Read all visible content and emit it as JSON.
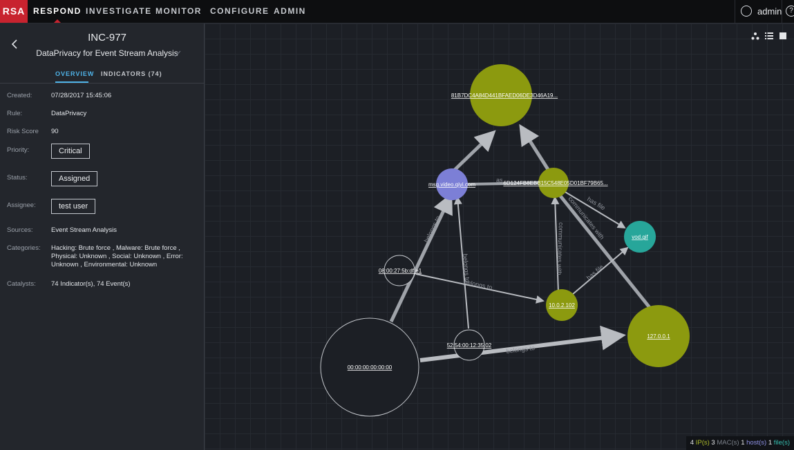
{
  "nav": {
    "logo": "RSA",
    "items": [
      "RESPOND",
      "INVESTIGATE",
      "MONITOR",
      "CONFIGURE",
      "ADMIN"
    ],
    "user": "admin",
    "help": "?"
  },
  "incident": {
    "id": "INC-977",
    "name": "DataPrivacy for Event Stream Analysis",
    "tabs": [
      "OVERVIEW",
      "INDICATORS (74)"
    ],
    "fields": {
      "created_label": "Created:",
      "created": "07/28/2017 15:45:06",
      "rule_label": "Rule:",
      "rule": "DataPrivacy",
      "risk_label": "Risk Score",
      "risk": "90",
      "priority_label": "Priority:",
      "priority": "Critical",
      "status_label": "Status:",
      "status": "Assigned",
      "assignee_label": "Assignee:",
      "assignee": "test user",
      "sources_label": "Sources:",
      "sources": "Event Stream Analysis",
      "categories_label": "Categories:",
      "categories": "Hacking: Brute force , Malware: Brute force , Physical: Unknown , Social: Unknown , Error: Unknown , Environmental: Unknown",
      "catalysts_label": "Catalysts:",
      "catalysts": "74 Indicator(s), 74 Event(s)"
    }
  },
  "graph": {
    "nodes": {
      "hash1": "81B7DC4A84D441BFAED06DE3D46A19...",
      "hash2": "6D124FB8EBB15C548E05D01BF79B65...",
      "host": "msg.video.qiyi.com",
      "file": "vod.gif",
      "mac1": "08:00:27:5b:df:e1",
      "ip1": "10.0.2.102",
      "ip2": "127.0.0.1",
      "mac2": "52:54:00:12:35:02",
      "mac3": "00:00:00:00:00:00"
    },
    "edges": {
      "belongs_to": "belongs to",
      "communicates_with": "communicates with",
      "has_file": "has file",
      "as": "as"
    }
  },
  "legend": {
    "ip_count": "4",
    "ip_label": "IP(s)",
    "mac_count": "3",
    "mac_label": "MAC(s)",
    "host_count": "1",
    "host_label": "host(s)",
    "file_count": "1",
    "file_label": "file(s)"
  },
  "colors": {
    "brand": "#c8232f",
    "accent": "#4fb3e8",
    "ip_node": "#8c9a0f",
    "host_node": "#7c7fd6",
    "file_node": "#27a69a"
  }
}
